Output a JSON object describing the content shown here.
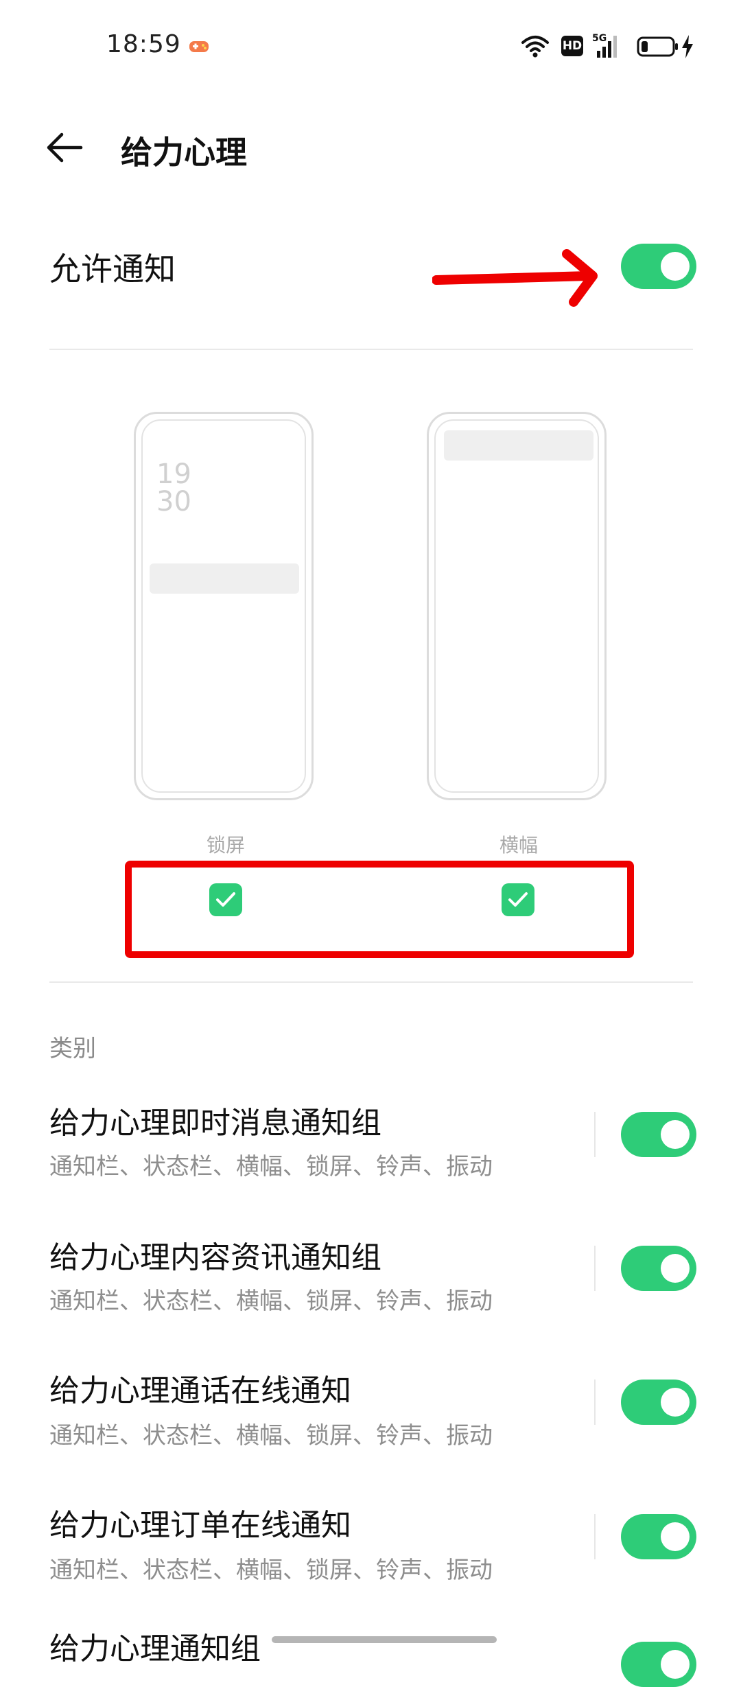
{
  "status_bar": {
    "time": "18:59",
    "icons": [
      "game-icon",
      "wifi-icon",
      "hd-icon",
      "signal-5g-icon",
      "battery-icon",
      "charging-icon"
    ],
    "hd_label": "HD",
    "network_label": "5G"
  },
  "header": {
    "back_icon": "arrow-left-icon",
    "title": "给力心理"
  },
  "allow_notification": {
    "label": "允许通知",
    "enabled": true
  },
  "previews": {
    "lock_screen": {
      "label": "锁屏",
      "clock_hour": "19",
      "clock_minute": "30",
      "checked": true
    },
    "banner": {
      "label": "横幅",
      "checked": true
    }
  },
  "categories": {
    "section_label": "类别",
    "items": [
      {
        "title": "给力心理即时消息通知组",
        "subtitle": "通知栏、状态栏、横幅、锁屏、铃声、振动",
        "enabled": true
      },
      {
        "title": "给力心理内容资讯通知组",
        "subtitle": "通知栏、状态栏、横幅、锁屏、铃声、振动",
        "enabled": true
      },
      {
        "title": "给力心理通话在线通知",
        "subtitle": "通知栏、状态栏、横幅、锁屏、铃声、振动",
        "enabled": true
      },
      {
        "title": "给力心理订单在线通知",
        "subtitle": "通知栏、状态栏、横幅、锁屏、铃声、振动",
        "enabled": true
      },
      {
        "title": "给力心理通知组",
        "enabled": true
      }
    ]
  },
  "colors": {
    "toggle_on": "#2ecc78",
    "annotation_red": "#ee0000"
  }
}
